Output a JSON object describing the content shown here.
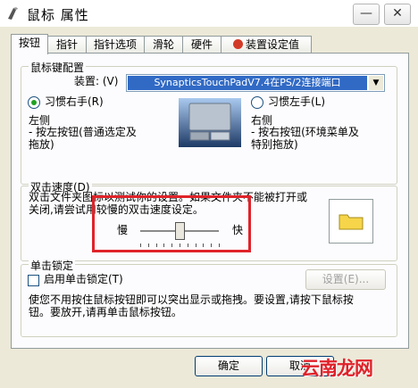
{
  "window": {
    "title": "鼠标 属性",
    "minimize_glyph": "—",
    "close_glyph": "✕"
  },
  "tabs": [
    {
      "label": "按钮"
    },
    {
      "label": "指针"
    },
    {
      "label": "指针选项"
    },
    {
      "label": "滑轮"
    },
    {
      "label": "硬件"
    },
    {
      "label": "装置设定值"
    }
  ],
  "button_config": {
    "group_title": "鼠标键配置",
    "device_label": "装置: (V)",
    "device_value": "SynapticsTouchPadV7.4在PS/2连接端口",
    "right_hand_label": "习惯右手(R)",
    "left_hand_label": "习惯左手(L)",
    "left_heading": "左侧",
    "left_desc_1": "- 按左按钮(普通选定及",
    "left_desc_2": "拖放)",
    "right_heading": "右侧",
    "right_desc_1": "- 按右按钮(环境菜单及",
    "right_desc_2": "特别拖放)",
    "selected": "right-hand"
  },
  "double_click": {
    "group_title": "双击速度(D)",
    "desc_1": "双击文件夹图标以测试你的设置。如果文件夹不能被打开或",
    "desc_2": "关闭,请尝试用较慢的双击速度设定。",
    "slow_label": "慢",
    "fast_label": "快",
    "speed_fraction": 0.5
  },
  "click_lock": {
    "group_title": "单击锁定",
    "enable_label": "启用单击锁定(T)",
    "enabled": false,
    "settings_button": "设置(E)...",
    "desc_1": "使您不用按住鼠标按钮即可以突出显示或拖拽。要设置,请按下鼠标按",
    "desc_2": "钮。要放开,请再单击鼠标按钮。"
  },
  "footer": {
    "ok_label": "确定",
    "cancel_label": "取消"
  },
  "watermark": "云南龙网",
  "colors": {
    "highlight_box": "#e0232a",
    "selection": "#316ac5",
    "watermark": "#e0212a"
  }
}
